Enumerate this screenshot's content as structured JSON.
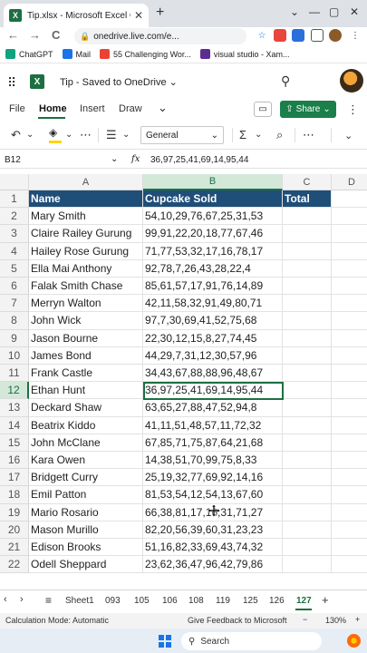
{
  "browser": {
    "tab_title": "Tip.xlsx - Microsoft Excel Online",
    "tab_close": "✕",
    "new_tab": "+",
    "url": "onedrive.live.com/e...",
    "window_controls": [
      "⌄",
      "—",
      "▢",
      "✕"
    ],
    "nav": {
      "back": "←",
      "forward": "→",
      "reload": "C"
    },
    "bookmarks": [
      {
        "label": "ChatGPT",
        "color": "#10a37f"
      },
      {
        "label": "Mail",
        "color": "#1a73e8"
      },
      {
        "label": "55 Challenging Wor...",
        "color": "#ea4335"
      },
      {
        "label": "visual studio - Xam...",
        "color": "#5c2d91"
      }
    ]
  },
  "app": {
    "doc_title": "Tip  -  Saved to OneDrive",
    "doc_title_chevron": "⌄",
    "ribbon_tabs": [
      "File",
      "Home",
      "Insert",
      "Draw"
    ],
    "active_tab": "Home",
    "share_label": "Share",
    "number_format": "General"
  },
  "formula_bar": {
    "name_box": "B12",
    "fx": "fx",
    "value": "36,97,25,41,69,14,95,44"
  },
  "grid": {
    "columns": [
      "A",
      "B",
      "C",
      "D"
    ],
    "selected_column": "B",
    "selected_row": 12,
    "header_row": {
      "name": "Name",
      "sold": "Cupcake Sold",
      "total": "Total"
    },
    "rows": [
      {
        "num": 1
      },
      {
        "num": 2,
        "name": "Mary Smith",
        "sold": "54,10,29,76,67,25,31,53"
      },
      {
        "num": 3,
        "name": "Claire Railey Gurung",
        "sold": "99,91,22,20,18,77,67,46"
      },
      {
        "num": 4,
        "name": "Hailey Rose Gurung",
        "sold": "71,77,53,32,17,16,78,17"
      },
      {
        "num": 5,
        "name": "Ella Mai Anthony",
        "sold": "92,78,7,26,43,28,22,4"
      },
      {
        "num": 6,
        "name": "Falak Smith Chase",
        "sold": "85,61,57,17,91,76,14,89"
      },
      {
        "num": 7,
        "name": "Merryn Walton",
        "sold": "42,11,58,32,91,49,80,71"
      },
      {
        "num": 8,
        "name": "John Wick",
        "sold": "97,7,30,69,41,52,75,68"
      },
      {
        "num": 9,
        "name": "Jason Bourne",
        "sold": "22,30,12,15,8,27,74,45"
      },
      {
        "num": 10,
        "name": "James Bond",
        "sold": "44,29,7,31,12,30,57,96"
      },
      {
        "num": 11,
        "name": "Frank Castle",
        "sold": "34,43,67,88,88,96,48,67"
      },
      {
        "num": 12,
        "name": "Ethan Hunt",
        "sold": "36,97,25,41,69,14,95,44"
      },
      {
        "num": 13,
        "name": "Deckard Shaw",
        "sold": "63,65,27,88,47,52,94,8"
      },
      {
        "num": 14,
        "name": "Beatrix Kiddo",
        "sold": "41,11,51,48,57,11,72,32"
      },
      {
        "num": 15,
        "name": "John McClane",
        "sold": "67,85,71,75,87,64,21,68"
      },
      {
        "num": 16,
        "name": "Kara Owen",
        "sold": "14,38,51,70,99,75,8,33"
      },
      {
        "num": 17,
        "name": "Bridgett Curry",
        "sold": "25,19,32,77,69,92,14,16"
      },
      {
        "num": 18,
        "name": "Emil Patton",
        "sold": "81,53,54,12,54,13,67,60"
      },
      {
        "num": 19,
        "name": "Mario Rosario",
        "sold": "66,38,81,17,16,31,71,27"
      },
      {
        "num": 20,
        "name": "Mason Murillo",
        "sold": "82,20,56,39,60,31,23,23"
      },
      {
        "num": 21,
        "name": "Edison Brooks",
        "sold": "51,16,82,33,69,43,74,32"
      },
      {
        "num": 22,
        "name": "Odell Sheppard",
        "sold": "23,62,36,47,96,42,79,86"
      }
    ]
  },
  "sheets": {
    "menu": "≡",
    "tabs": [
      "Sheet1",
      "093",
      "105",
      "106",
      "108",
      "119",
      "125",
      "126",
      "127"
    ],
    "active": "127",
    "add": "+"
  },
  "status": {
    "mode": "Calculation Mode: Automatic",
    "feedback": "Give Feedback to Microsoft",
    "zoom": "130%",
    "zoom_minus": "−",
    "zoom_plus": "+"
  },
  "taskbar": {
    "search_placeholder": "Search"
  },
  "colors": {
    "excel_green": "#1d6f42",
    "header_fill": "#1f4e79",
    "share": "#1a7f4b"
  }
}
